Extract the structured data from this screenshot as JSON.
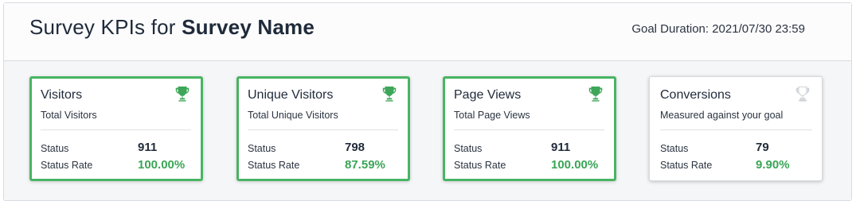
{
  "header": {
    "title_prefix": "Survey KPIs for",
    "title_name": "Survey Name",
    "goal_label": "Goal Duration:",
    "goal_value": "2021/07/30 23:59"
  },
  "labels": {
    "status": "Status",
    "status_rate": "Status Rate"
  },
  "colors": {
    "met_border": "#48b463",
    "met_trophy": "#3da658",
    "unmet_trophy": "#d3d6da",
    "rate_value": "#3aa556"
  },
  "cards": [
    {
      "title": "Visitors",
      "subtitle": "Total Visitors",
      "status": "911",
      "rate": "100.00%",
      "goal_met": true,
      "icon": "trophy-icon"
    },
    {
      "title": "Unique Visitors",
      "subtitle": "Total Unique Visitors",
      "status": "798",
      "rate": "87.59%",
      "goal_met": true,
      "icon": "trophy-icon"
    },
    {
      "title": "Page Views",
      "subtitle": "Total Page Views",
      "status": "911",
      "rate": "100.00%",
      "goal_met": true,
      "icon": "trophy-icon"
    },
    {
      "title": "Conversions",
      "subtitle": "Measured against your goal",
      "status": "79",
      "rate": "9.90%",
      "goal_met": false,
      "icon": "trophy-icon"
    }
  ]
}
